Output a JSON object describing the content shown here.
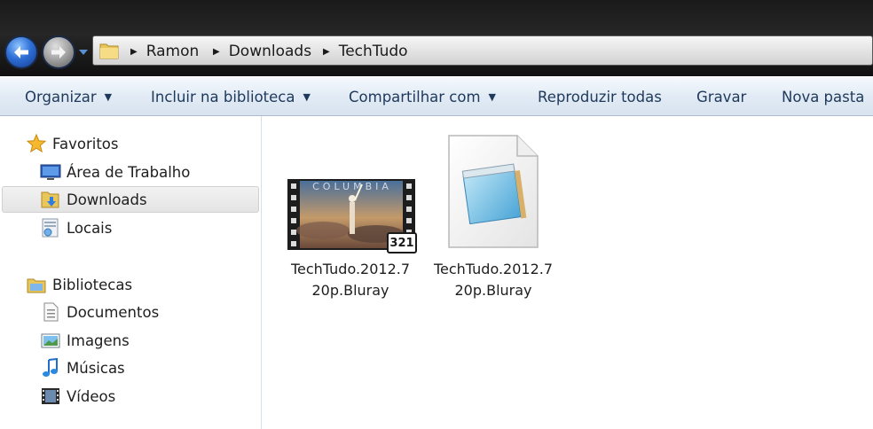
{
  "address": {
    "crumbs": [
      "Ramon",
      "Downloads",
      "TechTudo"
    ]
  },
  "toolbar": {
    "organize": "Organizar",
    "include_library": "Incluir na biblioteca",
    "share_with": "Compartilhar com",
    "play_all": "Reproduzir todas",
    "burn": "Gravar",
    "new_folder": "Nova pasta"
  },
  "nav": {
    "favorites": "Favoritos",
    "desktop": "Área de Trabalho",
    "downloads": "Downloads",
    "recent": "Locais",
    "libraries": "Bibliotecas",
    "documents": "Documentos",
    "pictures": "Imagens",
    "music": "Músicas",
    "videos": "Vídeos"
  },
  "files": [
    {
      "name_line1": "TechTudo.2012.7",
      "name_line2": "20p.Bluray",
      "thumb_text": "COLUMBIA",
      "badge": "321"
    },
    {
      "name_line1": "TechTudo.2012.7",
      "name_line2": "20p.Bluray"
    }
  ],
  "colors": {
    "toolbar_text": "#1e395b",
    "selection_bg": "#e8e8e8",
    "title_bg": "#1a1a1a"
  }
}
